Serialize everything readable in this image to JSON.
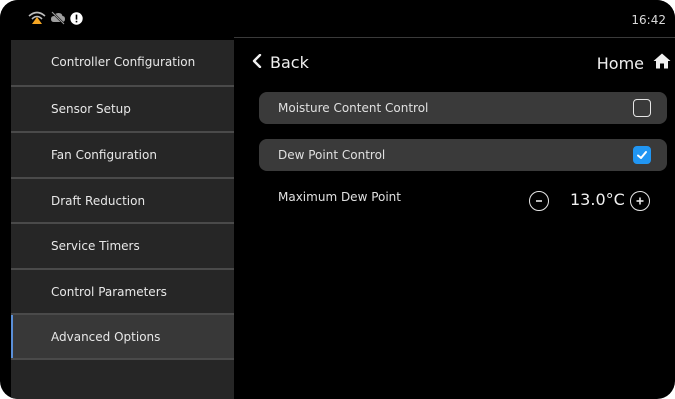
{
  "status": {
    "time": "16:42",
    "icons": [
      "wifi-warning-icon",
      "cloud-offline-icon",
      "alert-icon"
    ]
  },
  "sidebar": {
    "items": [
      {
        "label": "Controller Configuration",
        "active": false
      },
      {
        "label": "Sensor Setup",
        "active": false
      },
      {
        "label": "Fan Configuration",
        "active": false
      },
      {
        "label": "Draft Reduction",
        "active": false
      },
      {
        "label": "Service Timers",
        "active": false
      },
      {
        "label": "Control Parameters",
        "active": false
      },
      {
        "label": "Advanced Options",
        "active": true
      }
    ]
  },
  "header": {
    "back_label": "Back",
    "home_label": "Home"
  },
  "options": [
    {
      "label": "Moisture Content Control",
      "checked": false
    },
    {
      "label": "Dew Point Control",
      "checked": true
    }
  ],
  "max_dew_point": {
    "label": "Maximum Dew Point",
    "value": "13.0°C"
  },
  "colors": {
    "accent": "#2196f3",
    "background": "#000000",
    "sidebar": "#262626",
    "row": "#3a3a3a",
    "warning": "#f5a623"
  }
}
